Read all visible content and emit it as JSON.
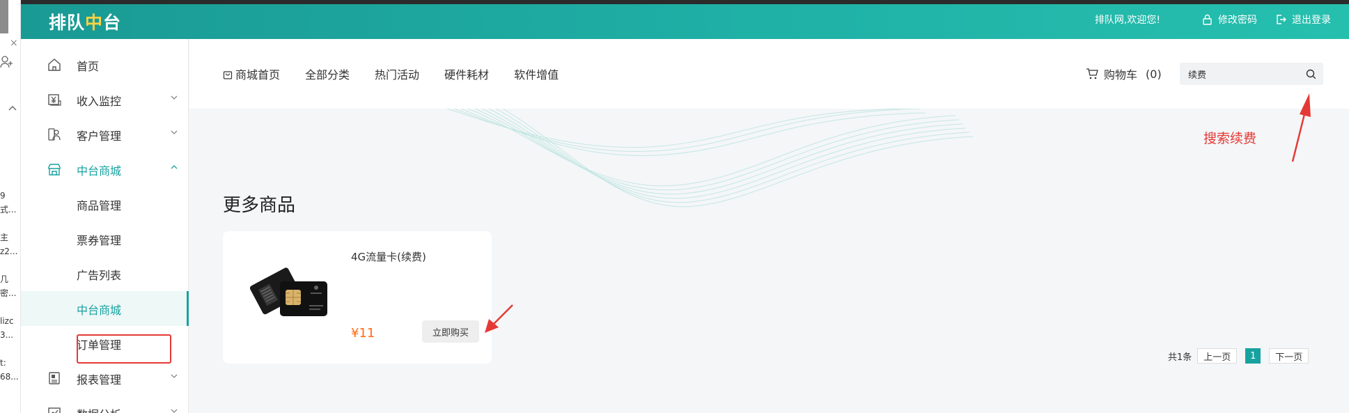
{
  "colors": {
    "header_gradient_start": "#1a9a94",
    "header_gradient_end": "#26bfae",
    "accent": "#17a2a0",
    "logo_highlight": "#ffd23f",
    "price": "#ff6a13",
    "annotation": "#e53935"
  },
  "left_strip": {
    "items": [
      "9",
      "式...",
      "主",
      "z2...",
      "几",
      "密...",
      "lizc",
      "3...",
      "t:",
      "68..."
    ]
  },
  "header": {
    "logo_part1": "排队",
    "logo_part2": "中",
    "logo_part3": "台",
    "welcome": "排队网,欢迎您!",
    "change_password": "修改密码",
    "logout": "退出登录"
  },
  "sidebar": {
    "items": [
      {
        "label": "首页",
        "icon": "home-icon"
      },
      {
        "label": "收入监控",
        "icon": "income-icon"
      },
      {
        "label": "客户管理",
        "icon": "customer-icon"
      },
      {
        "label": "中台商城",
        "icon": "store-icon"
      },
      {
        "label": "报表管理",
        "icon": "report-icon"
      },
      {
        "label": "数据分析",
        "icon": "analysis-icon"
      }
    ],
    "sub_items": [
      "商品管理",
      "票券管理",
      "广告列表",
      "中台商城",
      "订单管理"
    ]
  },
  "nav": {
    "links": [
      "商城首页",
      "全部分类",
      "热门活动",
      "硬件耗材",
      "软件增值"
    ],
    "cart_label": "购物车",
    "cart_count": "(0)"
  },
  "search": {
    "value": "续费"
  },
  "annotation": {
    "search_note": "搜索续费"
  },
  "section": {
    "title": "更多商品"
  },
  "product": {
    "name": "4G流量卡(续费)",
    "price": "¥11",
    "buy_label": "立即购买"
  },
  "pagination": {
    "total": "共1条",
    "prev": "上一页",
    "current": "1",
    "next": "下一页"
  }
}
